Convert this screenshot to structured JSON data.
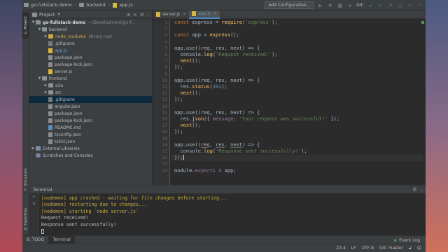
{
  "breadcrumbs": [
    "go-fullstack-demo",
    "backend",
    "app.js"
  ],
  "toolbar": {
    "add_configuration": "Add Configuration...",
    "git_label": "Git:"
  },
  "left_stripe": {
    "project_tab": "1: Project",
    "structure_tab": "7: Structure",
    "favorites_tab": "2: Favorites"
  },
  "project_panel": {
    "title": "Project",
    "dropdown_icon": "chevron-down-icon"
  },
  "tree": {
    "root": {
      "name": "go-fullstack-demo",
      "path": "~/Development/go-f..."
    },
    "backend": "backend",
    "node_modules": {
      "name": "node_modules",
      "note": "library root"
    },
    "backend_files": [
      ".gitignore",
      "app.js",
      "package.json",
      "package-lock.json",
      "server.js"
    ],
    "frontend": "frontend",
    "frontend_dirs": [
      "e2e",
      "src"
    ],
    "frontend_files": [
      ".gitignore",
      "angular.json",
      "package.json",
      "package-lock.json",
      "README.md",
      "tsconfig.json",
      "tslint.json"
    ],
    "external_libraries": "External Libraries",
    "scratches": "Scratches and Consoles"
  },
  "editor_tabs": [
    {
      "label": "server.js",
      "active": false
    },
    {
      "label": "app.js",
      "active": true
    }
  ],
  "line_numbers": [
    "1",
    "2",
    "3",
    "4",
    "5",
    "6",
    "7",
    "8",
    "9",
    "10",
    "11",
    "12",
    "13",
    "14",
    "15",
    "16",
    "17",
    "18",
    "19",
    "20",
    "21",
    "22",
    "23",
    "24"
  ],
  "code": {
    "l1": {
      "kw": "const",
      "a": " express = ",
      "fn": "require",
      "b": "(",
      "str": "'express'",
      "c": ");"
    },
    "l3": {
      "kw": "const",
      "a": " app = ",
      "fn": "express",
      "b": "();"
    },
    "l5": "app.use((req, res, next) => {",
    "l6": {
      "a": "  console.",
      "fn": "log",
      "b": "(",
      "str": "'Request received!'",
      "c": ");"
    },
    "l7": {
      "a": "  ",
      "fn": "next",
      "b": "();"
    },
    "l8": "});",
    "l10": "app.use((req, res, next) => {",
    "l11": {
      "a": "  res.",
      "fn": "status",
      "b": "(",
      "num": "201",
      "c": ");"
    },
    "l12": {
      "a": "  ",
      "fn": "next",
      "b": "();"
    },
    "l13": "});",
    "l15": "app.use((req, res, next) => {",
    "l16": {
      "a": "  res.",
      "fn": "json",
      "b": "({ ",
      "prop": "message",
      "c": ": ",
      "str": "'Your request was successful!'",
      "d": " });"
    },
    "l17": {
      "a": "  ",
      "fn": "next",
      "b": "();"
    },
    "l18": "});",
    "l20": {
      "a": "app.use((",
      "p1": "req",
      "s1": ", ",
      "p2": "res",
      "s2": ", ",
      "p3": "next",
      "b": ") => {"
    },
    "l21": {
      "a": "  console.",
      "fn": "log",
      "b": "(",
      "str": "'Response sent successfully!'",
      "c": ");"
    },
    "l22": "});",
    "l24": {
      "a": "module.",
      "prop": "exports",
      "b": " = app;"
    }
  },
  "terminal": {
    "title": "Terminal",
    "lines": [
      {
        "text": "[nodemon] app crashed - waiting for file changes before starting...",
        "color": "yellow"
      },
      {
        "text": "[nodemon] restarting due to changes...",
        "color": "yellow"
      },
      {
        "text": "[nodemon] starting `node server.js`",
        "color": "yellow"
      },
      {
        "text": "Request received!",
        "color": "default"
      },
      {
        "text": "Response sent successfully!",
        "color": "default"
      }
    ]
  },
  "bottom_tabs": {
    "todo": "6: TODO",
    "terminal": "Terminal",
    "event_log": "Event Log"
  },
  "status": {
    "position": "22:4",
    "line_sep": "LF",
    "encoding": "UTF-8",
    "git_branch": "Git: master"
  },
  "colors": {
    "keyword": "#cc7832",
    "string": "#6a8759",
    "function": "#ffc66d",
    "number": "#6897bb",
    "selection": "#0d293e",
    "nodemon": "#c8a93e"
  }
}
